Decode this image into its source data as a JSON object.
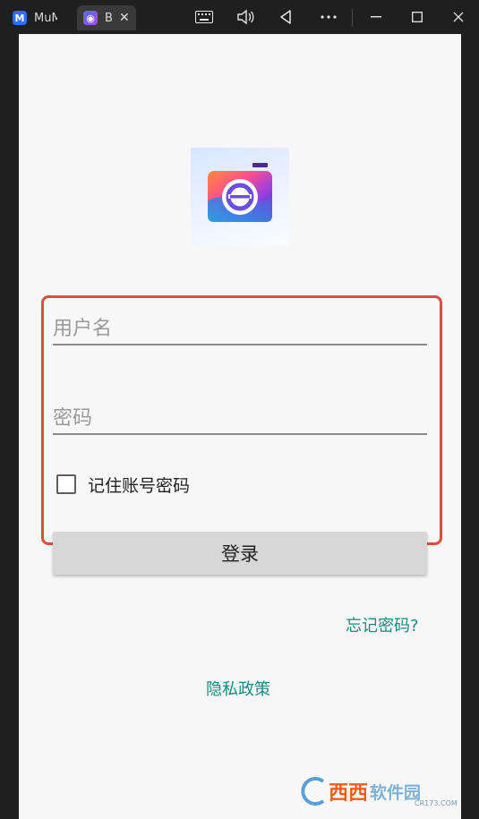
{
  "titlebar": {
    "tabs": [
      {
        "label": "MuMu",
        "icon": "mumu-logo-icon"
      },
      {
        "label": "Bloom",
        "icon": "app-logo-icon"
      }
    ],
    "icons": [
      "keyboard-icon",
      "volume-icon",
      "back-icon",
      "more-icon",
      "minimize-icon",
      "maximize-icon",
      "close-icon"
    ]
  },
  "login": {
    "username_placeholder": "用户名",
    "password_placeholder": "密码",
    "remember_label": "记住账号密码",
    "remember_checked": false,
    "login_label": "登录",
    "forgot_label": "忘记密码?",
    "privacy_label": "隐私政策"
  },
  "colors": {
    "link": "#1a8a80",
    "highlight_frame": "#d9503c",
    "button_bg": "#d7d7d7"
  },
  "watermark": {
    "brand": "西西",
    "subtitle": "软件园",
    "site": "CR173.COM"
  }
}
